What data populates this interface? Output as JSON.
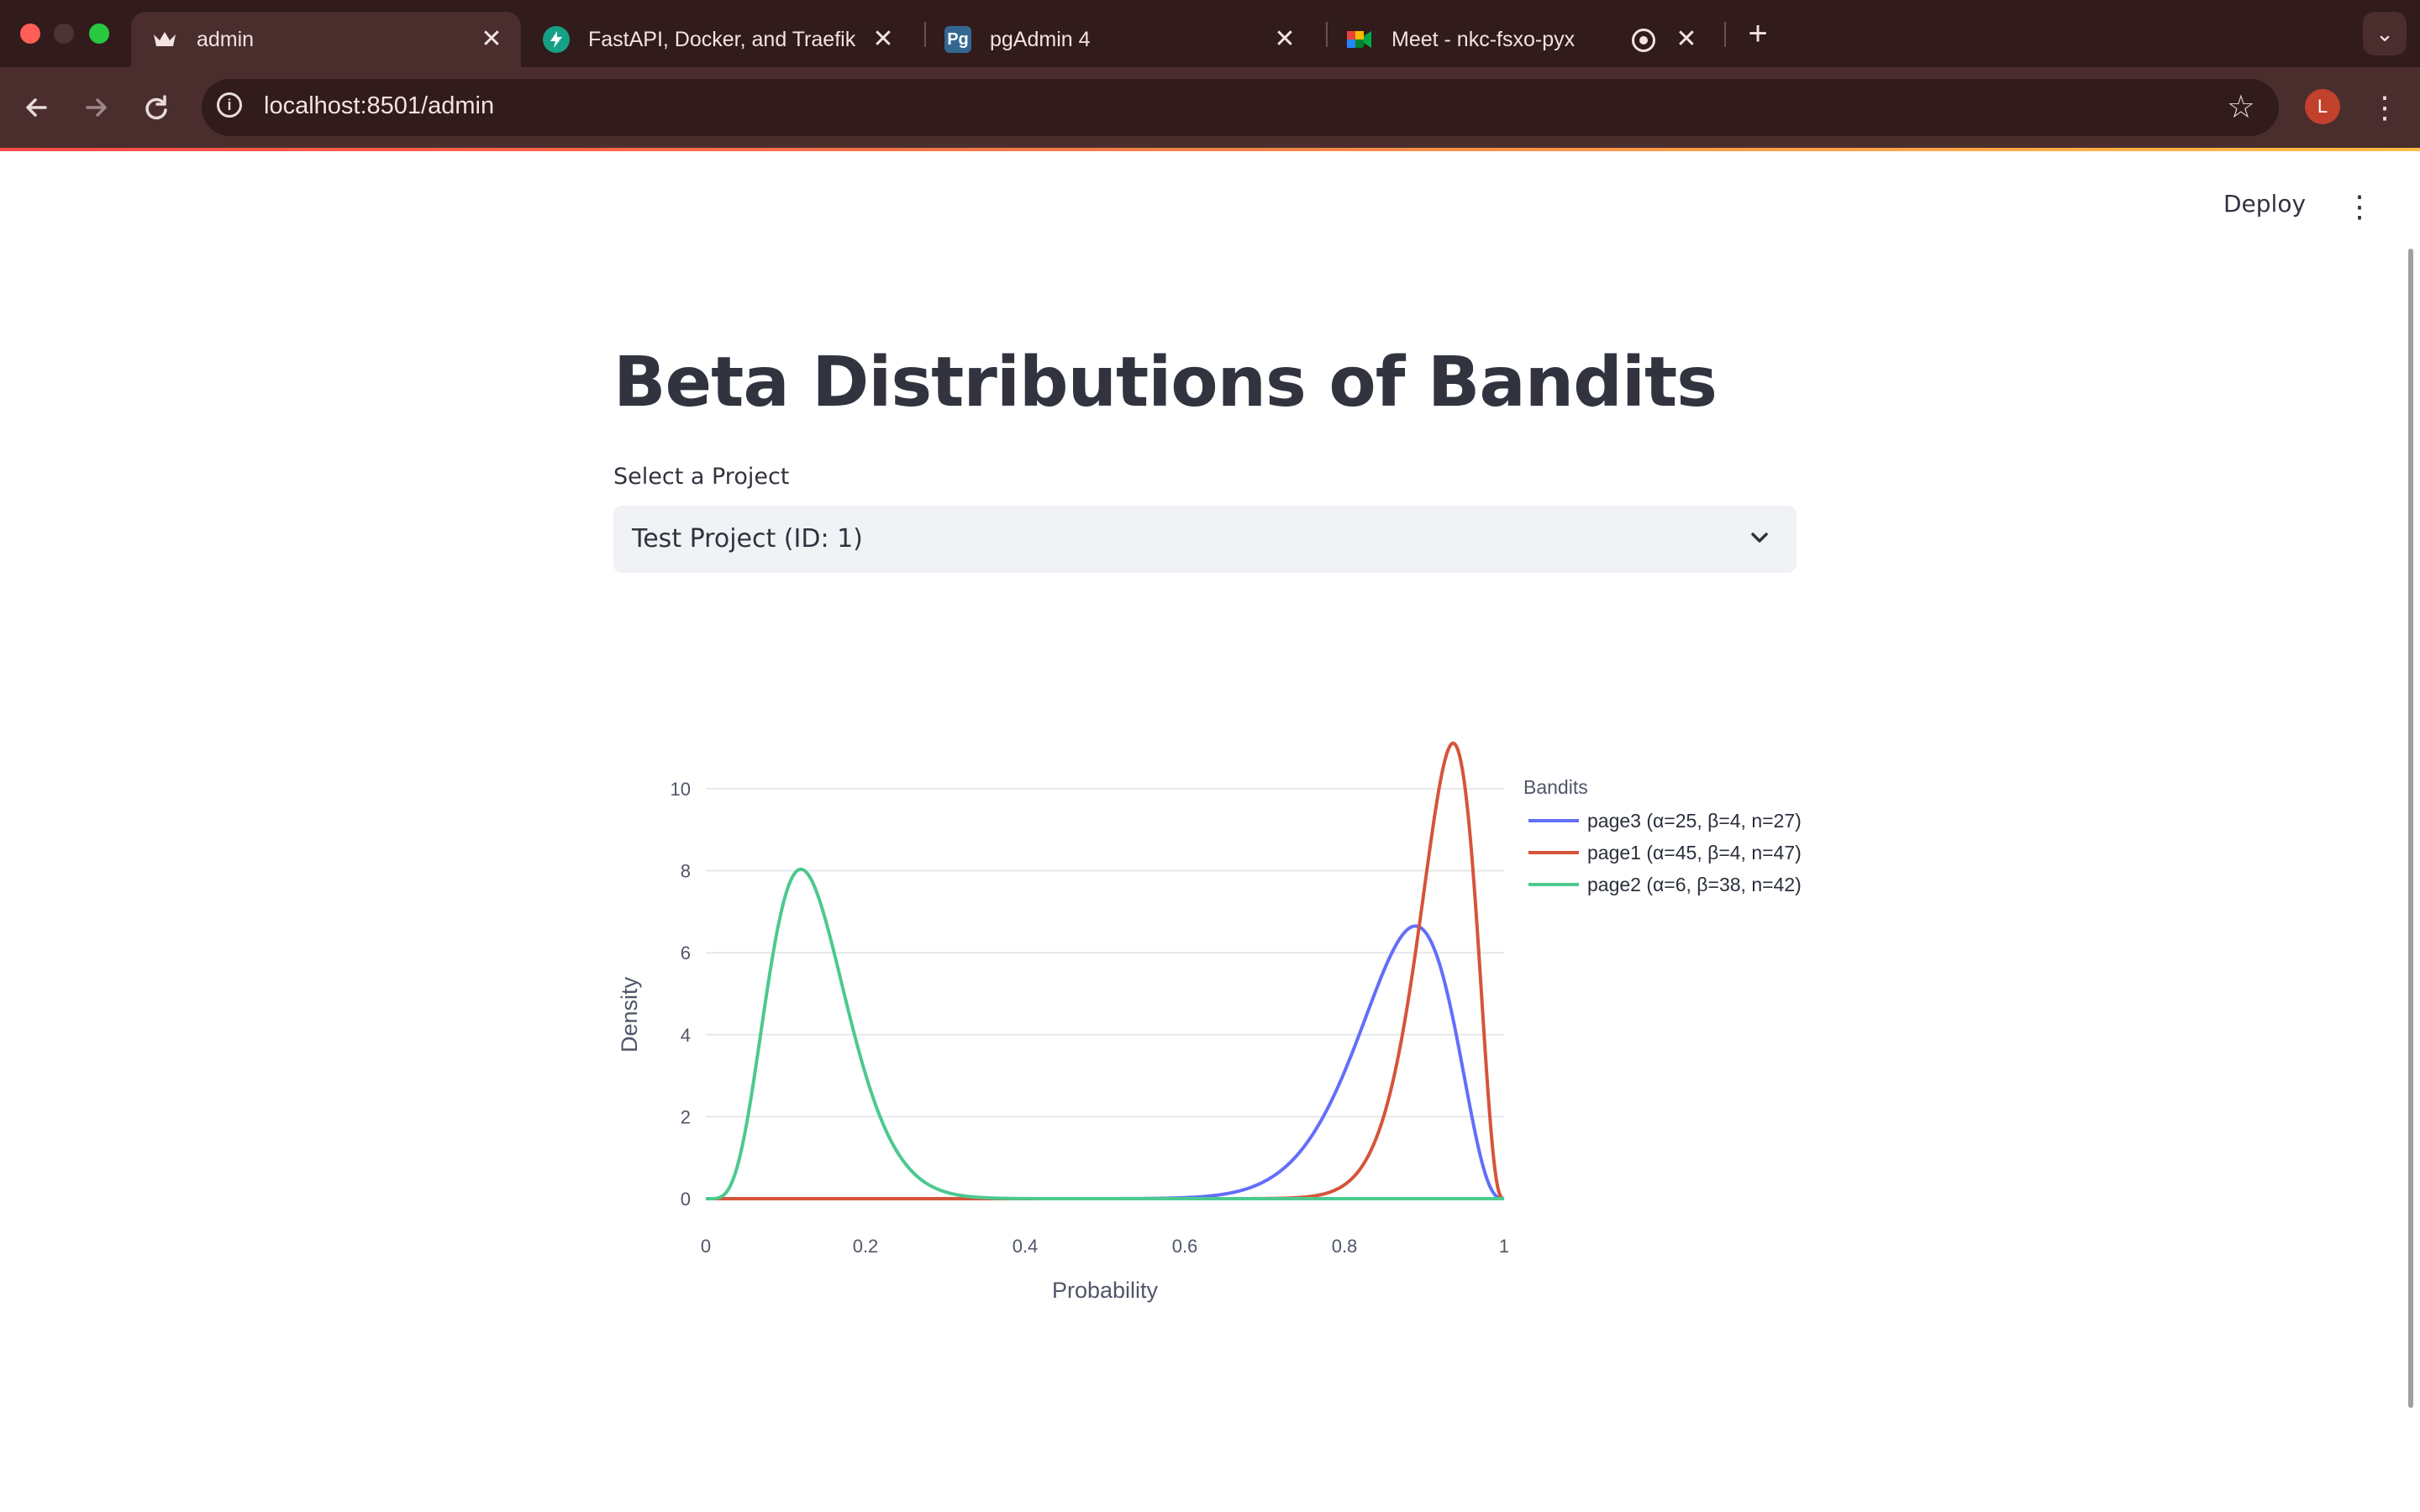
{
  "browser": {
    "tabs": [
      {
        "title": "admin",
        "favicon": "crown-icon",
        "active": true
      },
      {
        "title": "FastAPI, Docker, and Traefik",
        "favicon": "fastapi-icon",
        "active": false
      },
      {
        "title": "pgAdmin 4",
        "favicon": "pg-icon",
        "favicon_text": "Pg",
        "active": false
      },
      {
        "title": "Meet - nkc-fsxo-pyx",
        "favicon": "meet-icon",
        "active": false
      }
    ],
    "url": "localhost:8501/admin",
    "profile_initial": "L"
  },
  "app": {
    "deploy_label": "Deploy",
    "title": "Beta Distributions of Bandits",
    "select_label": "Select a Project",
    "selected_project": "Test Project (ID: 1)"
  },
  "chart_data": {
    "type": "line",
    "title": "",
    "xlabel": "Probability",
    "ylabel": "Density",
    "xlim": [
      0,
      1
    ],
    "ylim": [
      0,
      11.3
    ],
    "xticks": [
      0,
      0.2,
      0.4,
      0.6,
      0.8,
      1
    ],
    "xtick_labels": [
      "0",
      "0.2",
      "0.4",
      "0.6",
      "0.8",
      "1"
    ],
    "yticks": [
      0,
      2,
      4,
      6,
      8,
      10
    ],
    "ytick_labels": [
      "0",
      "2",
      "4",
      "6",
      "8",
      "10"
    ],
    "grid": true,
    "legend_title": "Bandits",
    "legend_position": "right",
    "series": [
      {
        "name": "page3 (α=25, β=4, n=27)",
        "alpha": 25,
        "beta": 4,
        "color": "#636efa"
      },
      {
        "name": "page1 (α=45, β=4, n=47)",
        "alpha": 45,
        "beta": 4,
        "color": "#d6543a"
      },
      {
        "name": "page2 (α=6, β=38, n=42)",
        "alpha": 6,
        "beta": 38,
        "color": "#4cc98f"
      }
    ]
  }
}
